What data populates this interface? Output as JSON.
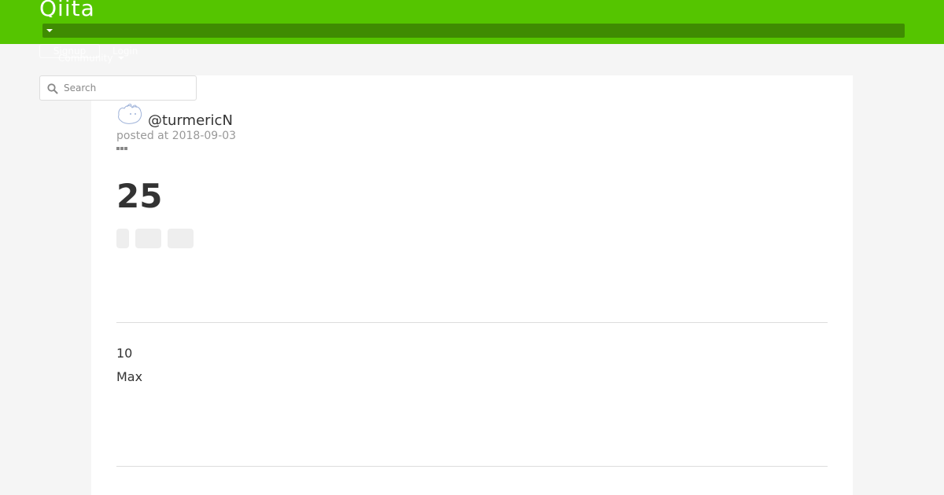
{
  "header": {
    "logo": "Qiita",
    "signup_label": "Signup",
    "login_label": "Login",
    "community_label": "Community",
    "brand_color": "#55c500",
    "bar_color": "#3f8c02"
  },
  "search": {
    "placeholder": "Search",
    "icon": "search-icon"
  },
  "article": {
    "author": "@turmericN",
    "avatar_icon": "avatar-image",
    "posted_at": "posted at 2018-09-03",
    "more_icon": "more-dots-icon",
    "title": "25",
    "body": [
      "10",
      "Max"
    ]
  }
}
